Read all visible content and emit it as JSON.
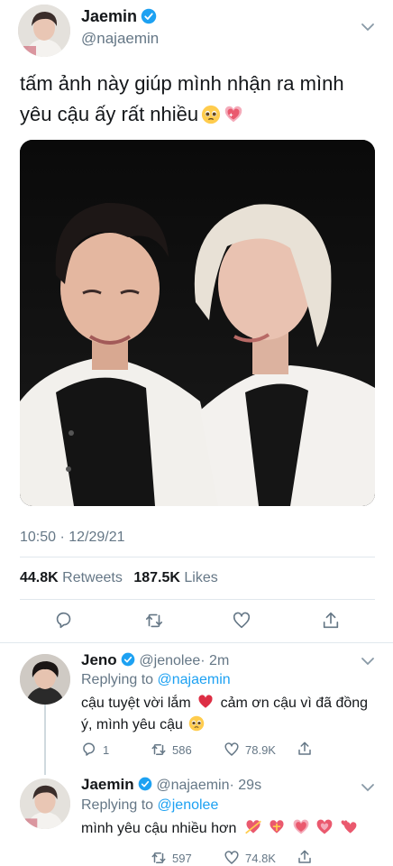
{
  "main": {
    "author": {
      "name": "Jaemin",
      "handle": "@najaemin"
    },
    "text": "tấm ảnh này giúp mình nhận ra mình yêu cậu ấy rất nhiều",
    "emojis": [
      "pleading-face",
      "sparkling-heart"
    ],
    "time": "10:50 · 12/29/21",
    "retweets": "44.8K",
    "retweets_label": "Retweets",
    "likes": "187.5K",
    "likes_label": "Likes"
  },
  "reply1": {
    "name": "Jeno",
    "handle": "@jenolee",
    "time": "· 2m",
    "replying_prefix": "Replying to",
    "replying_to": "@najaemin",
    "text_a": "cậu tuyệt vời lắm",
    "text_b": "cảm ơn cậu vì đã đồng ý, mình yêu cậu",
    "replies": "1",
    "retweets": "586",
    "likes": "78.9K"
  },
  "reply2": {
    "name": "Jaemin",
    "handle": "@najaemin",
    "time": "· 29s",
    "replying_prefix": "Replying to",
    "replying_to": "@jenolee",
    "text": "mình yêu cậu nhiều hơn",
    "emojis": [
      "heart-with-arrow",
      "heart-with-ribbon",
      "sparkling-heart",
      "growing-heart",
      "revolving-hearts"
    ],
    "retweets": "597",
    "likes": "74.8K"
  },
  "colors": {
    "accent": "#1da1f2",
    "secondary_text": "#657786",
    "like_red": "#e0245e"
  }
}
